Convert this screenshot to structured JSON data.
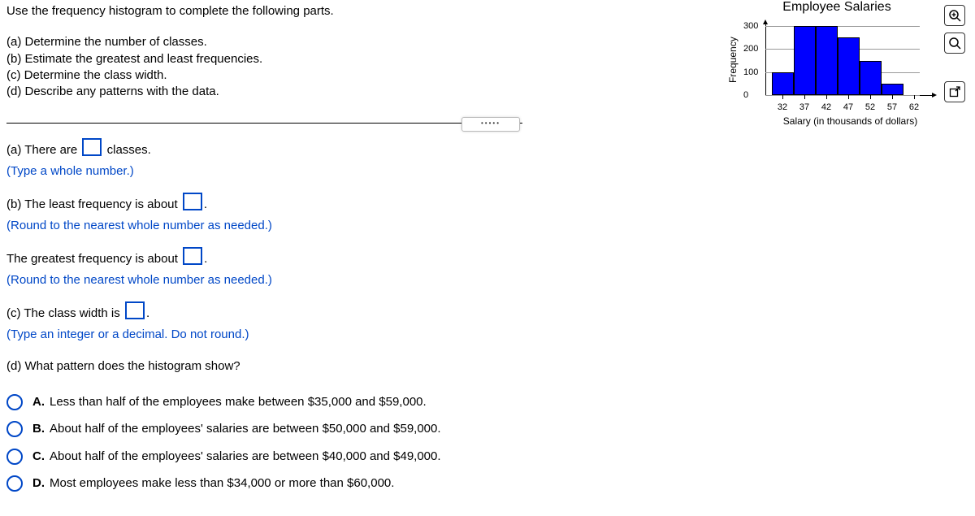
{
  "instructions": {
    "line1": "Use the frequency histogram to complete the following parts.",
    "a": "(a) Determine the number of classes.",
    "b": "(b) Estimate the greatest and least frequencies.",
    "c": "(c) Determine the class width.",
    "d": "(d) Describe any patterns with the data."
  },
  "answers": {
    "a_before": "(a) There are ",
    "a_after": " classes.",
    "a_help": "(Type a whole number.)",
    "b_least_before": "(b) The least frequency is about ",
    "b_help": "(Round to the nearest whole number as needed.)",
    "b_greatest_before": "The greatest frequency is about ",
    "c_before": "(c) The class width is ",
    "c_help": "(Type an integer or a decimal. Do not round.)",
    "d_prompt": "(d) What pattern does the histogram show?",
    "options": {
      "A": {
        "letter": "A.",
        "text": "Less than half of the employees make between $35,000 and $59,000."
      },
      "B": {
        "letter": "B.",
        "text": "About half of the employees' salaries are between $50,000 and $59,000."
      },
      "C": {
        "letter": "C.",
        "text": "About half of the employees' salaries are between $40,000 and $49,000."
      },
      "D": {
        "letter": "D.",
        "text": "Most employees make less than $34,000 or more than $60,000."
      }
    }
  },
  "period": ".",
  "chart_data": {
    "type": "bar",
    "title": "Employee Salaries",
    "xlabel_title": "Salary (in thousands of dollars)",
    "ylabel_title": "Frequency",
    "x_midpoints": [
      32,
      37,
      42,
      47,
      52,
      57,
      62
    ],
    "y_ticks": [
      0,
      100,
      200,
      300
    ],
    "ylim": [
      0,
      300
    ],
    "categories": [
      "32",
      "37",
      "42",
      "47",
      "52",
      "57",
      "62"
    ],
    "values": [
      100,
      300,
      300,
      250,
      150,
      50
    ]
  }
}
